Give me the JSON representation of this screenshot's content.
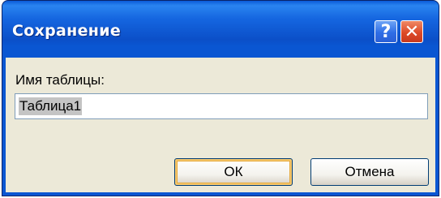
{
  "window": {
    "title": "Сохранение",
    "help_label": "?",
    "close_label": "✕"
  },
  "form": {
    "field_label": "Имя таблицы:",
    "field_value": "Таблица1"
  },
  "buttons": {
    "ok_label": "ОК",
    "cancel_label": "Отмена"
  },
  "colors": {
    "titlebar": "#0b4fc8",
    "client": "#ece9d8",
    "close": "#dd4a28"
  }
}
